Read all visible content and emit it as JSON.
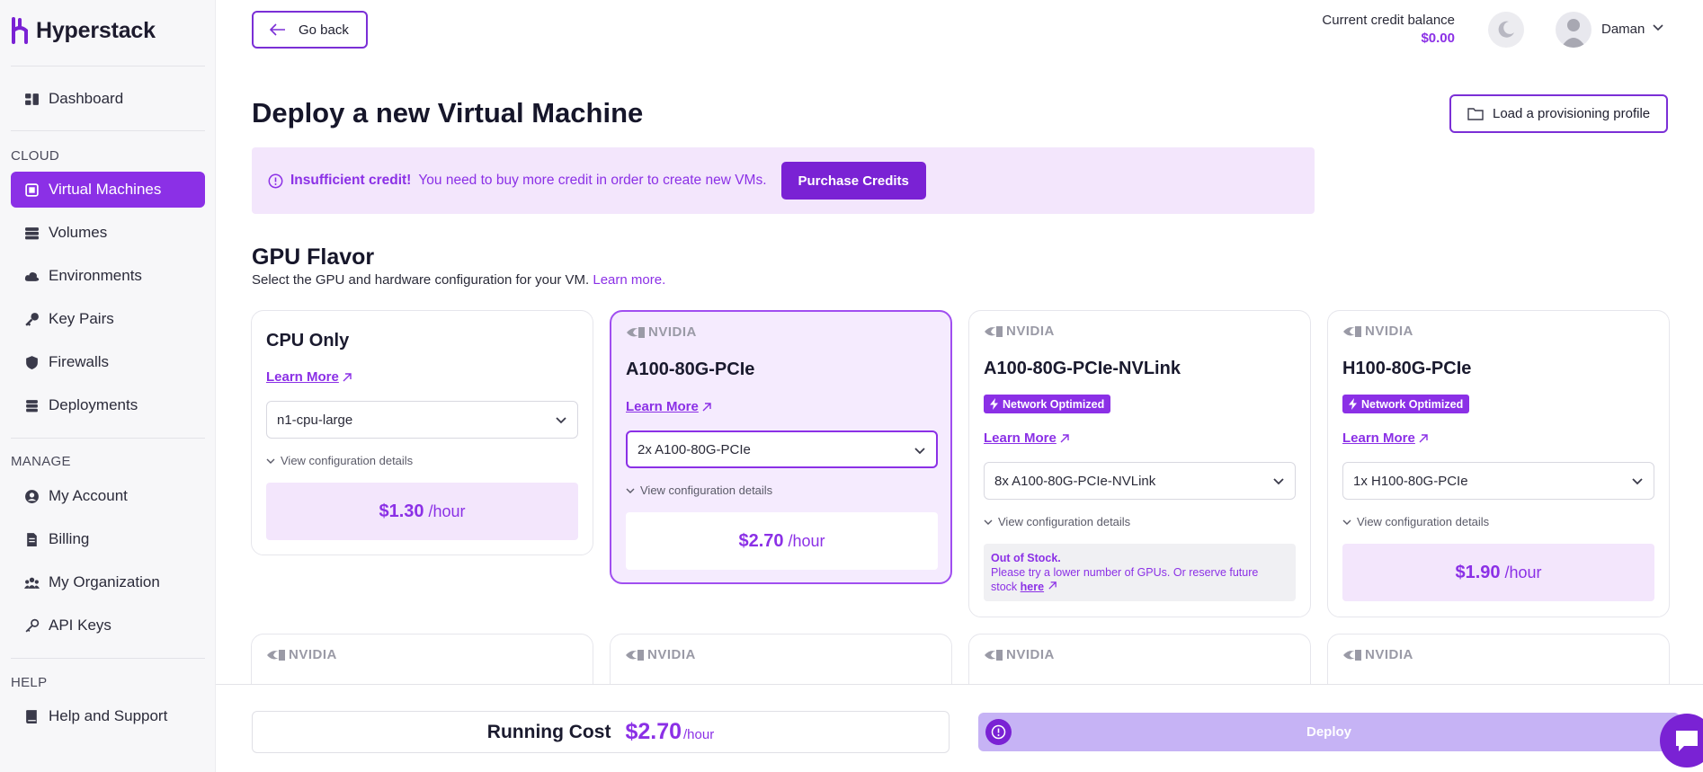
{
  "brand": {
    "name": "Hyperstack"
  },
  "sidebar": {
    "top_item": {
      "label": "Dashboard",
      "icon": "dashboard-icon"
    },
    "sections": [
      {
        "title": "CLOUD",
        "items": [
          {
            "label": "Virtual Machines",
            "icon": "vm-icon",
            "active": true
          },
          {
            "label": "Volumes",
            "icon": "volumes-icon"
          },
          {
            "label": "Environments",
            "icon": "cloud-icon"
          },
          {
            "label": "Key Pairs",
            "icon": "key-icon"
          },
          {
            "label": "Firewalls",
            "icon": "shield-icon"
          },
          {
            "label": "Deployments",
            "icon": "layers-icon"
          }
        ]
      },
      {
        "title": "MANAGE",
        "items": [
          {
            "label": "My Account",
            "icon": "user-circle-icon"
          },
          {
            "label": "Billing",
            "icon": "document-icon"
          },
          {
            "label": "My Organization",
            "icon": "team-icon"
          },
          {
            "label": "API Keys",
            "icon": "key-outline-icon"
          }
        ]
      },
      {
        "title": "HELP",
        "items": [
          {
            "label": "Help and Support",
            "icon": "book-icon"
          }
        ]
      }
    ]
  },
  "header": {
    "go_back": "Go back",
    "credit_label": "Current credit balance",
    "credit_value": "$0.00",
    "user_name": "Daman"
  },
  "page": {
    "title": "Deploy a new Virtual Machine",
    "load_profile": "Load a provisioning profile",
    "alert": {
      "title": "Insufficient credit!",
      "message": "You need to buy more credit in order to create new VMs.",
      "button": "Purchase Credits"
    },
    "gpu_section": {
      "title": "GPU Flavor",
      "subtitle": "Select the GPU and hardware configuration for your VM.",
      "learn_more": "Learn more."
    }
  },
  "cards": [
    {
      "vendor": "",
      "title": "CPU Only",
      "badge": "",
      "learn_more": "Learn More",
      "selected_option": "n1-cpu-large",
      "view_config": "View configuration details",
      "price": "$1.30",
      "per": "/hour",
      "selected": false
    },
    {
      "vendor": "NVIDIA",
      "title": "A100-80G-PCIe",
      "badge": "",
      "learn_more": "Learn More",
      "selected_option": "2x A100-80G-PCIe",
      "view_config": "View configuration details",
      "price": "$2.70",
      "per": "/hour",
      "selected": true
    },
    {
      "vendor": "NVIDIA",
      "title": "A100-80G-PCIe-NVLink",
      "badge": "Network Optimized",
      "learn_more": "Learn More",
      "selected_option": "8x A100-80G-PCIe-NVLink",
      "view_config": "View configuration details",
      "out_of_stock": {
        "title": "Out of Stock.",
        "line1": "Please try a lower number of GPUs. Or reserve future",
        "line2": "stock",
        "link": "here"
      },
      "selected": false
    },
    {
      "vendor": "NVIDIA",
      "title": "H100-80G-PCIe",
      "badge": "Network Optimized",
      "learn_more": "Learn More",
      "selected_option": "1x H100-80G-PCIe",
      "view_config": "View configuration details",
      "price": "$1.90",
      "per": "/hour",
      "selected": false
    }
  ],
  "next_row_vendors": [
    "NVIDIA",
    "NVIDIA",
    "NVIDIA",
    "NVIDIA"
  ],
  "footer": {
    "running_label": "Running Cost",
    "running_value": "$2.70",
    "running_per": "/hour",
    "deploy": "Deploy"
  },
  "colors": {
    "accent": "#8b30e6",
    "accent_dark": "#7a22d4",
    "alert_bg": "#f3e6fc",
    "deploy_disabled": "#c6b3f5"
  }
}
